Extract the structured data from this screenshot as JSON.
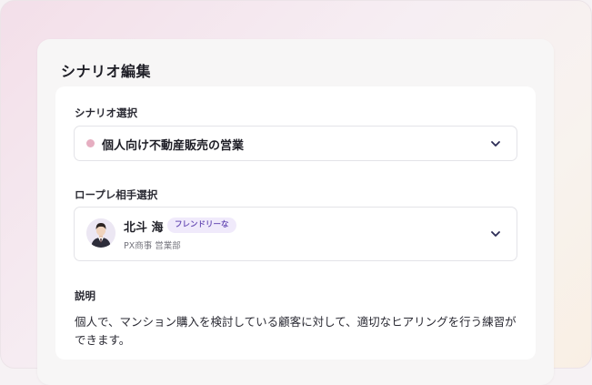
{
  "panel": {
    "title": "シナリオ編集"
  },
  "scenario": {
    "label": "シナリオ選択",
    "selected": "個人向け不動産販売の営業",
    "dot_color": "#e6aec1"
  },
  "partner": {
    "label": "ロープレ相手選択",
    "name": "北斗 海",
    "badge": "フレンドリーな",
    "subtitle": "PX商事 営業部"
  },
  "description": {
    "label": "説明",
    "text": "個人で、マンション購入を検討している顧客に対して、適切なヒアリングを行う練習ができます。"
  },
  "icons": {
    "dropdown": "chevron-down-icon",
    "avatar": "person-avatar"
  }
}
